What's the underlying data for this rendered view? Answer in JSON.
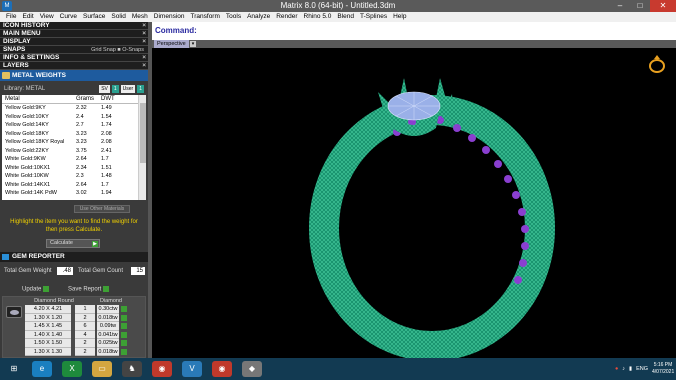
{
  "window": {
    "title": "Matrix 8.0 (64-bit) - Untitled.3dm",
    "app_icon": "matrix-app-icon"
  },
  "menu": [
    "File",
    "Edit",
    "View",
    "Curve",
    "Surface",
    "Solid",
    "Mesh",
    "Dimension",
    "Transform",
    "Tools",
    "Analyze",
    "Render",
    "Rhino 5.0",
    "Blend",
    "T-Splines",
    "Help"
  ],
  "panel": {
    "sections": [
      "ICON HISTORY",
      "MAIN MENU",
      "DISPLAY",
      "SNAPS",
      "INFO & SETTINGS",
      "LAYERS"
    ],
    "snap_options": "Grid Snap  ■ O-Snaps",
    "metal_weights": {
      "title": "METAL WEIGHTS",
      "library_label": "Library: METAL",
      "unit_sv": "SV",
      "unit_user": "User",
      "headers": [
        "Metal",
        "Grams",
        "DWT"
      ],
      "rows": [
        [
          "Yellow Gold:9KY",
          "2.32",
          "1.49"
        ],
        [
          "Yellow Gold:10KY",
          "2.4",
          "1.54"
        ],
        [
          "Yellow Gold:14KY",
          "2.7",
          "1.74"
        ],
        [
          "Yellow Gold:18KY",
          "3.23",
          "2.08"
        ],
        [
          "Yellow Gold:18KY Royal",
          "3.23",
          "2.08"
        ],
        [
          "Yellow Gold:22KY",
          "3.75",
          "2.41"
        ],
        [
          "White Gold:9KW",
          "2.64",
          "1.7"
        ],
        [
          "White Gold:10KX1",
          "2.34",
          "1.51"
        ],
        [
          "White Gold:10KW",
          "2.3",
          "1.48"
        ],
        [
          "White Gold:14KX1",
          "2.64",
          "1.7"
        ],
        [
          "White Gold:14K PdW",
          "3.02",
          "1.94"
        ]
      ],
      "hidden_button": "Use Other Materials",
      "hint": "Highlight the item you want to find the weight for then press Calculate.",
      "calculate": "Calculate"
    },
    "gem_reporter": {
      "title": "GEM REPORTER",
      "total_weight_label": "Total Gem Weight",
      "total_weight_value": ".48",
      "total_count_label": "Total Gem Count",
      "total_count_value": "15",
      "update": "Update",
      "save_report": "Save Report",
      "headers": [
        "Diamond Round",
        "Diamond"
      ],
      "rows": [
        [
          "4.20 X 4.21",
          "1",
          "0.30ctw"
        ],
        [
          "1.30 X 1.20",
          "2",
          "0.018tw"
        ],
        [
          "1.45 X 1.45",
          "6",
          "0.09tw"
        ],
        [
          "1.40 X 1.40",
          "4",
          "0.041tw"
        ],
        [
          "1.50 X 1.50",
          "2",
          "0.025tw"
        ],
        [
          "1.30 X 1.30",
          "2",
          "0.018tw"
        ]
      ]
    }
  },
  "command": {
    "label": "Command:"
  },
  "viewport": {
    "tab": "Perspective"
  },
  "taskbar": {
    "apps": [
      "ie-icon",
      "excel-icon",
      "file-explorer-icon",
      "rhino-icon",
      "chrome-icon",
      "vsd-icon",
      "chrome-icon",
      "matrix-icon"
    ],
    "lang": "ENG",
    "time": "5:16 PM",
    "date": "4/07/2021"
  },
  "colors": {
    "ring": "#1fa57a",
    "gems": "#8a3fd0",
    "panel_header": "#1e5b9e",
    "hint": "#f0d000"
  }
}
